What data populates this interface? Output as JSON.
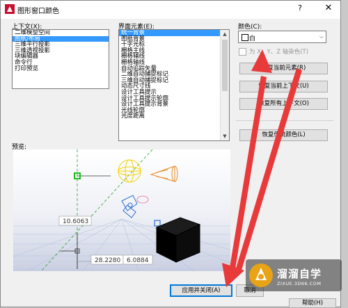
{
  "dialog": {
    "title": "图形窗口颜色",
    "help": "?",
    "close": "✕"
  },
  "context": {
    "label": "上下文(X):",
    "items": [
      "二维模型空间",
      "图纸/布局",
      "三维平行投影",
      "三维透视投影",
      "块编辑器",
      "命令行",
      "打印预览"
    ],
    "selected": 1
  },
  "elements": {
    "label": "界面元素(E):",
    "items": [
      "统一背景",
      "图纸背景",
      "十字光标",
      "栅格主线",
      "栅格辅线",
      "栅格轴线",
      "自动追踪矢量",
      "二维自动捕捉标记",
      "三维自动捕捉标记",
      "动态尺寸线",
      "设计工具提示",
      "设计工具提示轮廓",
      "设计工具提示背景",
      "光线轮廓",
      "光度距离"
    ],
    "selected": 0
  },
  "color": {
    "label": "颜色(C):",
    "value": "白",
    "swatch": "#ffffff",
    "tint_checkbox": "为 X、Y、Z 轴染色(T)"
  },
  "buttons": {
    "restore_element": "恢复当前元素(R)",
    "restore_context": "恢复当前上下文(U)",
    "restore_all": "恢复所有上下文(O)",
    "restore_classic": "恢复传统颜色(L)",
    "apply_close": "应用并关闭(A)",
    "cancel": "取消",
    "help": "帮助(H)"
  },
  "preview": {
    "label": "预览:",
    "dims": [
      "10.6063",
      "28.2280",
      "6.0884"
    ]
  },
  "watermark": {
    "brand": "溜溜自学",
    "site": "ZIXUE.3D66.COM"
  },
  "colors": {
    "accent": "#3399ff",
    "arrow": "#e83a3a",
    "default_border": "#0078d7"
  }
}
